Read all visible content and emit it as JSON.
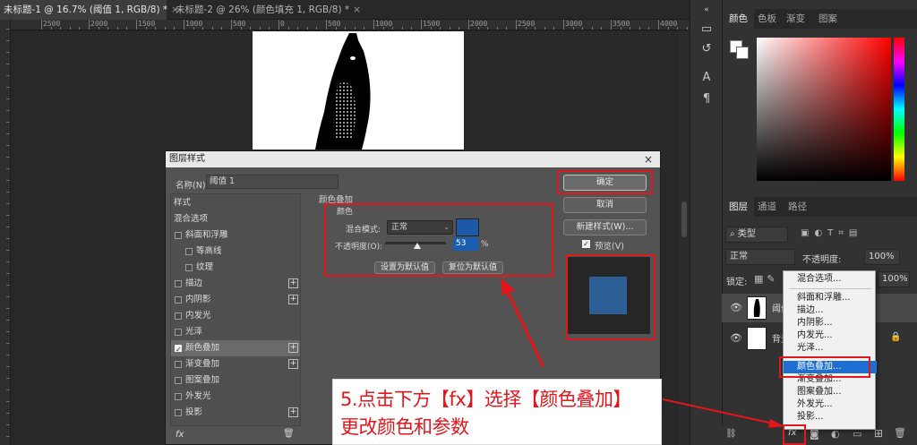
{
  "tabs": [
    {
      "title": "未标题-1 @ 16.7% (阈值 1, RGB/8) *",
      "close": "×"
    },
    {
      "title": "未标题-2 @ 26% (颜色填充 1, RGB/8) *",
      "close": "×"
    }
  ],
  "ruler": {
    "top_labels": [
      "2500",
      "2000",
      "1500",
      "1000",
      "500",
      "0",
      "500",
      "1000",
      "1500",
      "2000",
      "2500",
      "3000",
      "3500",
      "4000",
      "4500"
    ]
  },
  "right_panel": {
    "color_tabs": [
      "颜色",
      "色板",
      "渐变",
      "图案"
    ],
    "layers_tabs": [
      "图层",
      "通道",
      "路径"
    ],
    "filter_label": "类型",
    "blend_mode": "正常",
    "opacity_label": "不透明度:",
    "opacity_value": "100%",
    "lock_label": "锁定:",
    "fill_value": "100%",
    "layers": [
      {
        "name": "阈值 1"
      },
      {
        "name": "背景"
      }
    ],
    "fx_label": "fx"
  },
  "fx_menu": {
    "items": [
      "混合选项...",
      "斜面和浮雕...",
      "描边...",
      "内阴影...",
      "内发光...",
      "光泽...",
      "颜色叠加...",
      "渐变叠加...",
      "图案叠加...",
      "外发光...",
      "投影..."
    ],
    "selected": "颜色叠加..."
  },
  "dialog": {
    "title": "图层样式",
    "close": "×",
    "name_label": "名称(N):",
    "name_value": "阈值 1",
    "sidebar": {
      "header": "样式",
      "blend": "混合选项",
      "items": [
        {
          "label": "斜面和浮雕",
          "checked": false,
          "plus": false
        },
        {
          "label": "等高线",
          "checked": false,
          "plus": false
        },
        {
          "label": "纹理",
          "checked": false,
          "plus": false
        },
        {
          "label": "描边",
          "checked": false,
          "plus": true
        },
        {
          "label": "内阴影",
          "checked": false,
          "plus": true
        },
        {
          "label": "内发光",
          "checked": false,
          "plus": false
        },
        {
          "label": "光泽",
          "checked": false,
          "plus": false
        },
        {
          "label": "颜色叠加",
          "checked": true,
          "plus": true
        },
        {
          "label": "渐变叠加",
          "checked": false,
          "plus": true
        },
        {
          "label": "图案叠加",
          "checked": false,
          "plus": false
        },
        {
          "label": "外发光",
          "checked": false,
          "plus": false
        },
        {
          "label": "投影",
          "checked": false,
          "plus": true
        }
      ],
      "fx_label": "fx",
      "plus_glyph": "+"
    },
    "section_title": "颜色叠加",
    "subsection": "颜色",
    "blend_mode_label": "混合模式:",
    "blend_mode_value": "正常",
    "overlay_color": "#1c5aa8",
    "opacity_label": "不透明度(O):",
    "opacity_value": "53",
    "opacity_unit": "%",
    "btn_set_default": "设置为默认值",
    "btn_reset_default": "复位为默认值",
    "ok": "确定",
    "cancel": "取消",
    "new_style": "新建样式(W)...",
    "preview_label": "预览(V)",
    "preview_checked": true,
    "preview_color": "#2b5f96"
  },
  "annotation": {
    "line1": "5.点击下方【fx】选择【颜色叠加】",
    "line2": "更改颜色和参数",
    "color": "#e5151b"
  }
}
